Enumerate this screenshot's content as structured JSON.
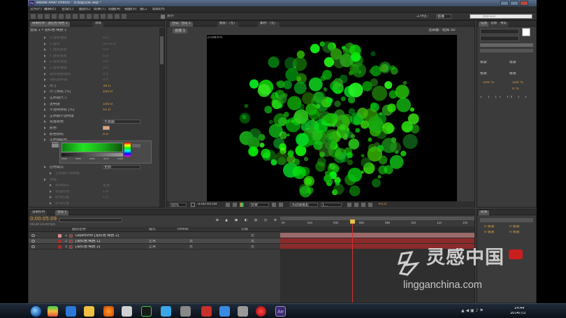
{
  "titlebar": {
    "title": "Adobe After Effects - 无标题项目.aep *"
  },
  "menu": [
    "文件(F)",
    "编辑(E)",
    "合成(C)",
    "图层(L)",
    "效果(T)",
    "动画(A)",
    "视图(V)",
    "窗口",
    "帮助(H)"
  ],
  "toolbar": {
    "align_label": "对齐",
    "workspace_label": "工作区：",
    "workspace_value": "标准",
    "search_placeholder": "搜索帮助"
  },
  "effects_panel": {
    "tab_label": "效果控件：变红色 纯色 1",
    "tab2_label": "项目",
    "breadcrumb": "合成 1 • 变红色 纯色 1",
    "rows": [
      {
        "label": "X 旋转速度",
        "value": "0.0",
        "dim": true
      },
      {
        "label": "X 旋转",
        "value": "0x+0.0°",
        "dim": true
      },
      {
        "label": "Y 旋转速度",
        "value": "0.0",
        "dim": true
      },
      {
        "label": "Y 旋转速度",
        "value": "0.0",
        "dim": true
      },
      {
        "label": "Z 旋转速度",
        "value": "0.0",
        "dim": true
      },
      {
        "label": "Z 旋转速度",
        "value": "0.0",
        "dim": true
      },
      {
        "label": "旋转速度随机",
        "value": "0.0",
        "dim": true
      },
      {
        "label": "随机旋转轴",
        "value": "0.0",
        "dim": true
      },
      {
        "label": "尺寸",
        "value": "39.0",
        "dim": false
      },
      {
        "label": "尺寸随机 [%]",
        "value": "100.0",
        "dim": false
      },
      {
        "label": "生命期尺寸",
        "value": "",
        "dim": false
      },
      {
        "label": "透明度",
        "value": "100.0",
        "dim": false
      },
      {
        "label": "不透明随机 [%]",
        "value": "51.0",
        "dim": false
      },
      {
        "label": "生命期不透明度",
        "value": "",
        "dim": false
      },
      {
        "label": "设置颜色",
        "value": "生命期",
        "dim": false
      },
      {
        "label": "颜色",
        "value": "",
        "dim": false
      },
      {
        "label": "颜色随机",
        "value": "0.0",
        "dim": false
      },
      {
        "label": "生命期颜色",
        "value": "",
        "dim": false
      }
    ],
    "gradient_ticks": [
      "0000",
      "0026",
      "0050",
      "0075",
      "0100"
    ],
    "preset_label": "PRESET",
    "apply_mode_label": "应用模式",
    "apply_mode_value": "无附",
    "dim_rows": [
      {
        "label": "生命期不透明度"
      },
      {
        "label": "物理"
      },
      {
        "label": "物理模式",
        "value": "坠落"
      },
      {
        "label": "物理时间",
        "value": "1.0"
      },
      {
        "label": "影响位置",
        "value": "1.0"
      },
      {
        "label": "影响位置"
      }
    ]
  },
  "viewer": {
    "tab_label": "合成：合成 1",
    "layer_tab": "图层：（无）",
    "footage_tab": "素材：（无）",
    "renderer_label": "渲染器：",
    "renderer_value": "经典 3D",
    "comp_name_button": "合成 1",
    "camera_label": "活动摄像机",
    "zoom": "50%",
    "timecode": "0:00:05:09",
    "resolution": "完整",
    "view_camera": "活动摄像机",
    "view_count": "1...",
    "exposure": "+0.0"
  },
  "right_panel": {
    "info_tab": "信息",
    "audio_tab": "音频",
    "preview_tab": "预览",
    "char_tab": "字符",
    "para_tab": "段落",
    "px_labels": [
      "像素",
      "像素",
      "像素",
      "像素"
    ],
    "pct_1": "100 %",
    "pct_2": "100 %",
    "tracking": "0 %",
    "para_bottom_tab": "段落",
    "para_values": [
      "0 像素",
      "0 像素",
      "0 像素",
      "0 像素"
    ]
  },
  "timeline": {
    "tab_render": "渲染队列",
    "tab_comp": "合成 1",
    "timecode": "0:00:05:09",
    "frames": "00134 (25.00 fps)",
    "col_name": "图层名称",
    "col_mode": "模式",
    "col_trkmat": "TrkMat",
    "col_parent": "父级",
    "ruler": [
      "0s",
      "02s",
      "04s",
      "06s",
      "08s",
      "10s",
      "12s",
      "14s"
    ],
    "layers": [
      {
        "num": "1",
        "name": "LayerEmit [变红色 纯色 2]",
        "mode": "",
        "trkmat": "",
        "parent": "无",
        "color": "#d98a8a"
      },
      {
        "num": "2",
        "name": "[变红色 纯色 1]",
        "mode": "正常",
        "trkmat": "无",
        "parent": "无",
        "color": "#a33030"
      },
      {
        "num": "3",
        "name": "[变红色 纯色 2]",
        "mode": "正常",
        "trkmat": "无",
        "parent": "无",
        "color": "#a33030"
      }
    ],
    "current_time_fraction": 0.37
  },
  "taskbar": {
    "time": "14:44",
    "date": "2014/7/2",
    "active_app": "Ae"
  },
  "watermark": {
    "cn": "灵感中国",
    "url": "lingganchina.com"
  },
  "colors": {
    "particle_green": "#2fe02f",
    "ae_purple": "#3b2a6a",
    "playhead": "#d43030",
    "orange_value": "#d9a040"
  }
}
